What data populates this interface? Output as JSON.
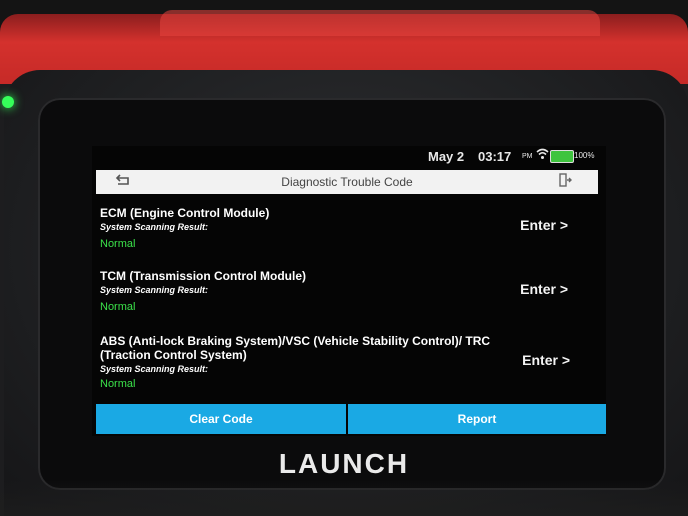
{
  "status_bar": {
    "date": "May 2",
    "time": "03:17",
    "ampm": "PM",
    "battery": "100%",
    "wifi_icon": "wifi-icon",
    "battery_icon": "battery-icon"
  },
  "header": {
    "title": "Diagnostic Trouble Code",
    "back_icon": "back-arrow-icon",
    "exit_icon": "exit-icon"
  },
  "modules": [
    {
      "name": "ECM (Engine Control Module)",
      "label": "System Scanning Result:",
      "result": "Normal",
      "enter": "Enter >"
    },
    {
      "name": "TCM (Transmission Control Module)",
      "label": "System Scanning Result:",
      "result": "Normal",
      "enter": "Enter >"
    },
    {
      "name": "ABS (Anti-lock Braking System)/VSC (Vehicle Stability Control)/ TRC (Traction Control System)",
      "label": "System Scanning Result:",
      "result": "Normal",
      "enter": "Enter >"
    }
  ],
  "buttons": {
    "clear": "Clear Code",
    "report": "Report"
  },
  "brand": "LAUNCH",
  "colors": {
    "accent": "#1aa9e4",
    "normal": "#3be24a",
    "case": "#d4312d"
  }
}
